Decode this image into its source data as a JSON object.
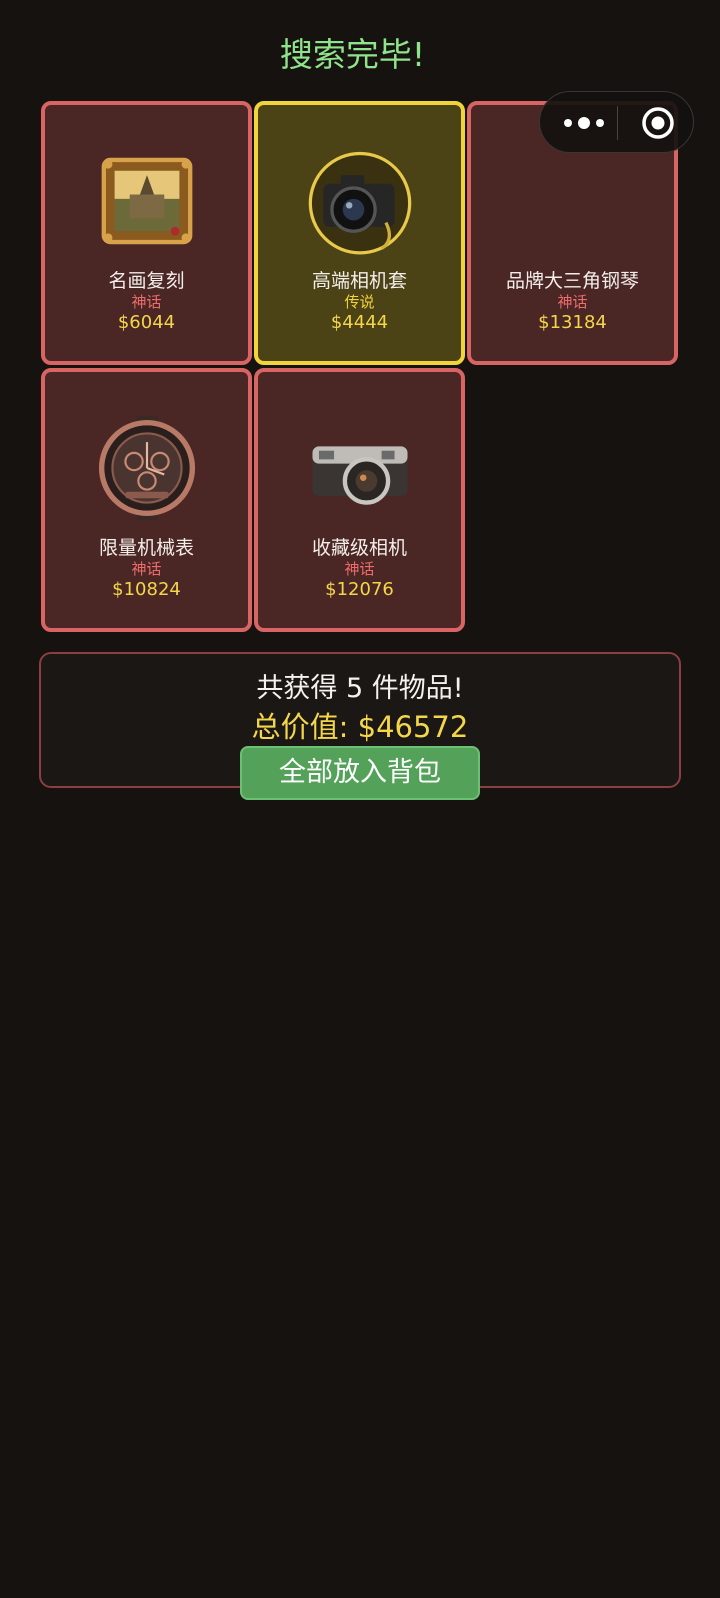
{
  "header": {
    "title": "搜索完毕!"
  },
  "capsule": {
    "more_icon": "more-dots-icon",
    "close_icon": "target-close-icon"
  },
  "items": [
    {
      "name": "名画复刻",
      "rarity": "神话",
      "price": "$6044",
      "icon": "framed-painting-icon"
    },
    {
      "name": "高端相机套",
      "rarity": "传说",
      "price": "$4444",
      "icon": "dslr-camera-icon"
    },
    {
      "name": "品牌大三角钢琴",
      "rarity": "神话",
      "price": "$13184",
      "icon": ""
    },
    {
      "name": "限量机械表",
      "rarity": "神话",
      "price": "$10824",
      "icon": "mechanical-watch-icon"
    },
    {
      "name": "收藏级相机",
      "rarity": "神话",
      "price": "$12076",
      "icon": "rangefinder-camera-icon"
    }
  ],
  "summary": {
    "count_text": "共获得 5 件物品!",
    "total_text": "总价值: $46572",
    "button_label": "全部放入背包"
  },
  "colors": {
    "mythic_border": "#d96464",
    "legendary_border": "#f0d43a",
    "title_green": "#8fe38a",
    "price_gold": "#f4d64a",
    "button_green": "#54a25a"
  }
}
